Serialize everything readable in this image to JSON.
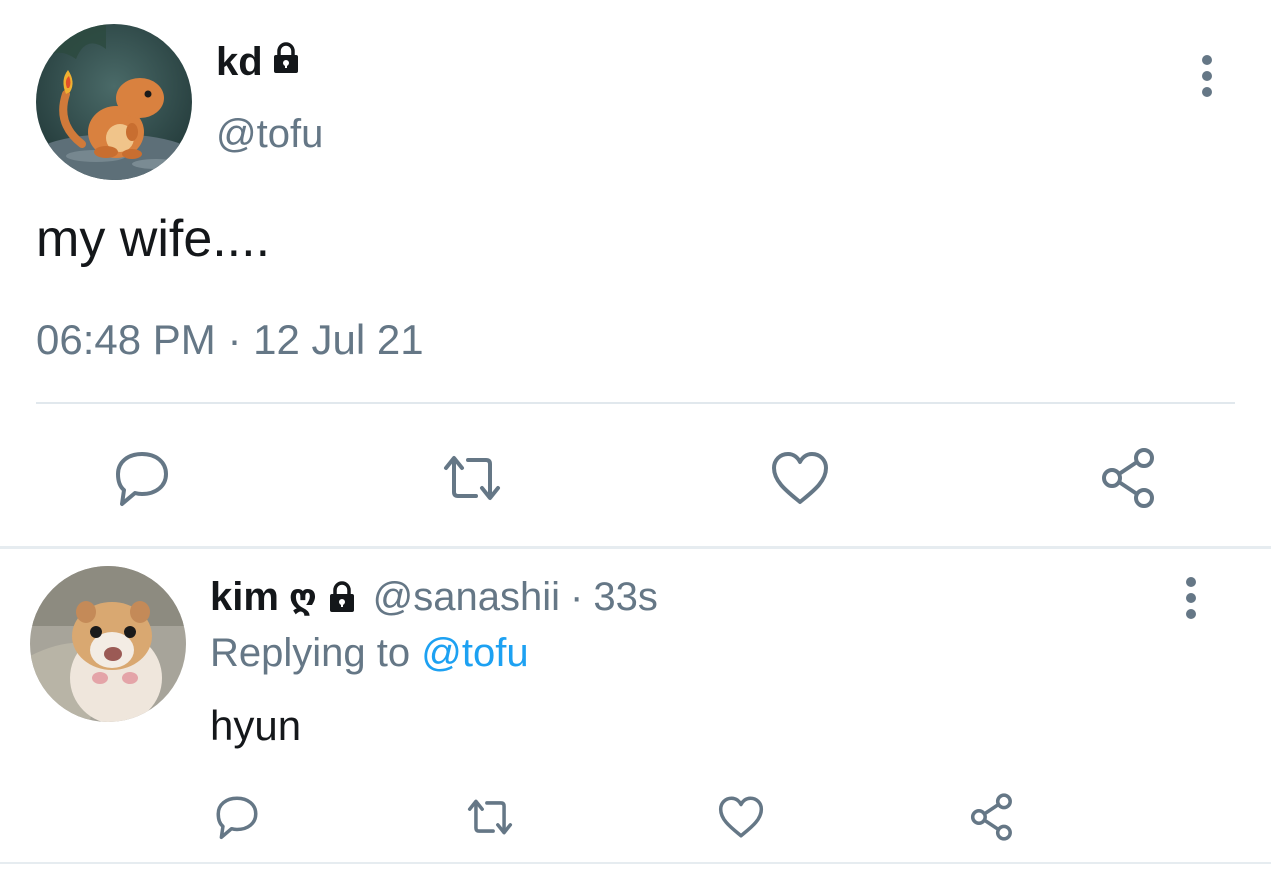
{
  "main_tweet": {
    "display_name": "kd",
    "handle": "@tofu",
    "text": "my wife....",
    "timestamp": "06:48 PM · 12 Jul 21",
    "protected_icon": "lock-icon",
    "avatar": "charmander-avatar",
    "actions": [
      "reply-icon",
      "retweet-icon",
      "like-icon",
      "share-icon"
    ]
  },
  "reply": {
    "display_name": "kim",
    "name_emoji": "ღ",
    "handle": "@sanashii",
    "separator": "·",
    "time": "33s",
    "replying_prefix": "Replying to",
    "replying_mention": "@tofu",
    "text": "hyun",
    "avatar": "hamster-avatar",
    "actions": [
      "reply-icon",
      "retweet-icon",
      "like-icon",
      "share-icon"
    ]
  },
  "colors": {
    "primary_text": "#14171a",
    "secondary_text": "#657786",
    "link": "#1da1f2",
    "divider": "#e1e8ed",
    "icon": "#657786"
  }
}
